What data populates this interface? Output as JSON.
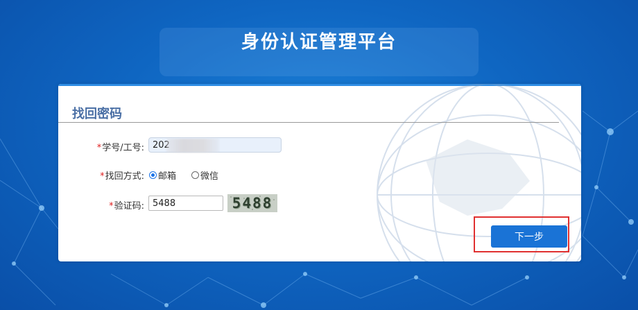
{
  "page_title": "身份认证管理平台",
  "card": {
    "title": "找回密码"
  },
  "form": {
    "id_field": {
      "label": "学号/工号:",
      "value": "202"
    },
    "method_field": {
      "label": "找回方式:",
      "options": [
        "邮箱",
        "微信"
      ],
      "selected": "邮箱"
    },
    "captcha_field": {
      "label": "验证码:",
      "value": "5488",
      "image_text": "5488"
    },
    "required_mark": "*"
  },
  "actions": {
    "next_label": "下一步"
  },
  "colors": {
    "background": "#0f66c2",
    "accent": "#1a73d6",
    "title_text": "#4a6fa5",
    "required": "#e02020",
    "highlight": "#e03030"
  },
  "icons": {
    "globe": "globe-graphic",
    "captcha": "captcha-image"
  }
}
